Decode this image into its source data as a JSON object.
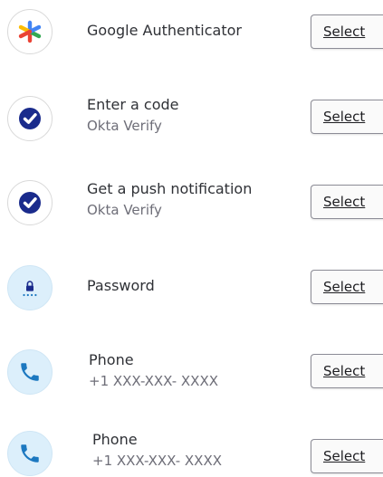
{
  "authenticators": [
    {
      "title": "Google Authenticator",
      "subtitle": "",
      "icon": "google-authenticator-icon",
      "button_label": "Select"
    },
    {
      "title": "Enter a code",
      "subtitle": "Okta Verify",
      "icon": "okta-verify-icon",
      "button_label": "Select"
    },
    {
      "title": "Get a push notification",
      "subtitle": "Okta Verify",
      "icon": "okta-verify-icon",
      "button_label": "Select"
    },
    {
      "title": "Password",
      "subtitle": "",
      "icon": "password-lock-icon",
      "button_label": "Select"
    },
    {
      "title": "Phone",
      "subtitle": "+1 XXX-XXX- XXXX",
      "icon": "phone-icon",
      "button_label": "Select"
    },
    {
      "title": "Phone",
      "subtitle": "+1 XXX-XXX- XXXX",
      "icon": "phone-icon",
      "button_label": "Select"
    }
  ],
  "colors": {
    "okta_navy": "#1a2b8c",
    "phone_blue": "#1c78c0",
    "icon_bg_blue": "#dceffb",
    "google_blue": "#4285f4",
    "google_red": "#ea4335",
    "google_yellow": "#fbbc04",
    "google_green": "#34a853"
  }
}
